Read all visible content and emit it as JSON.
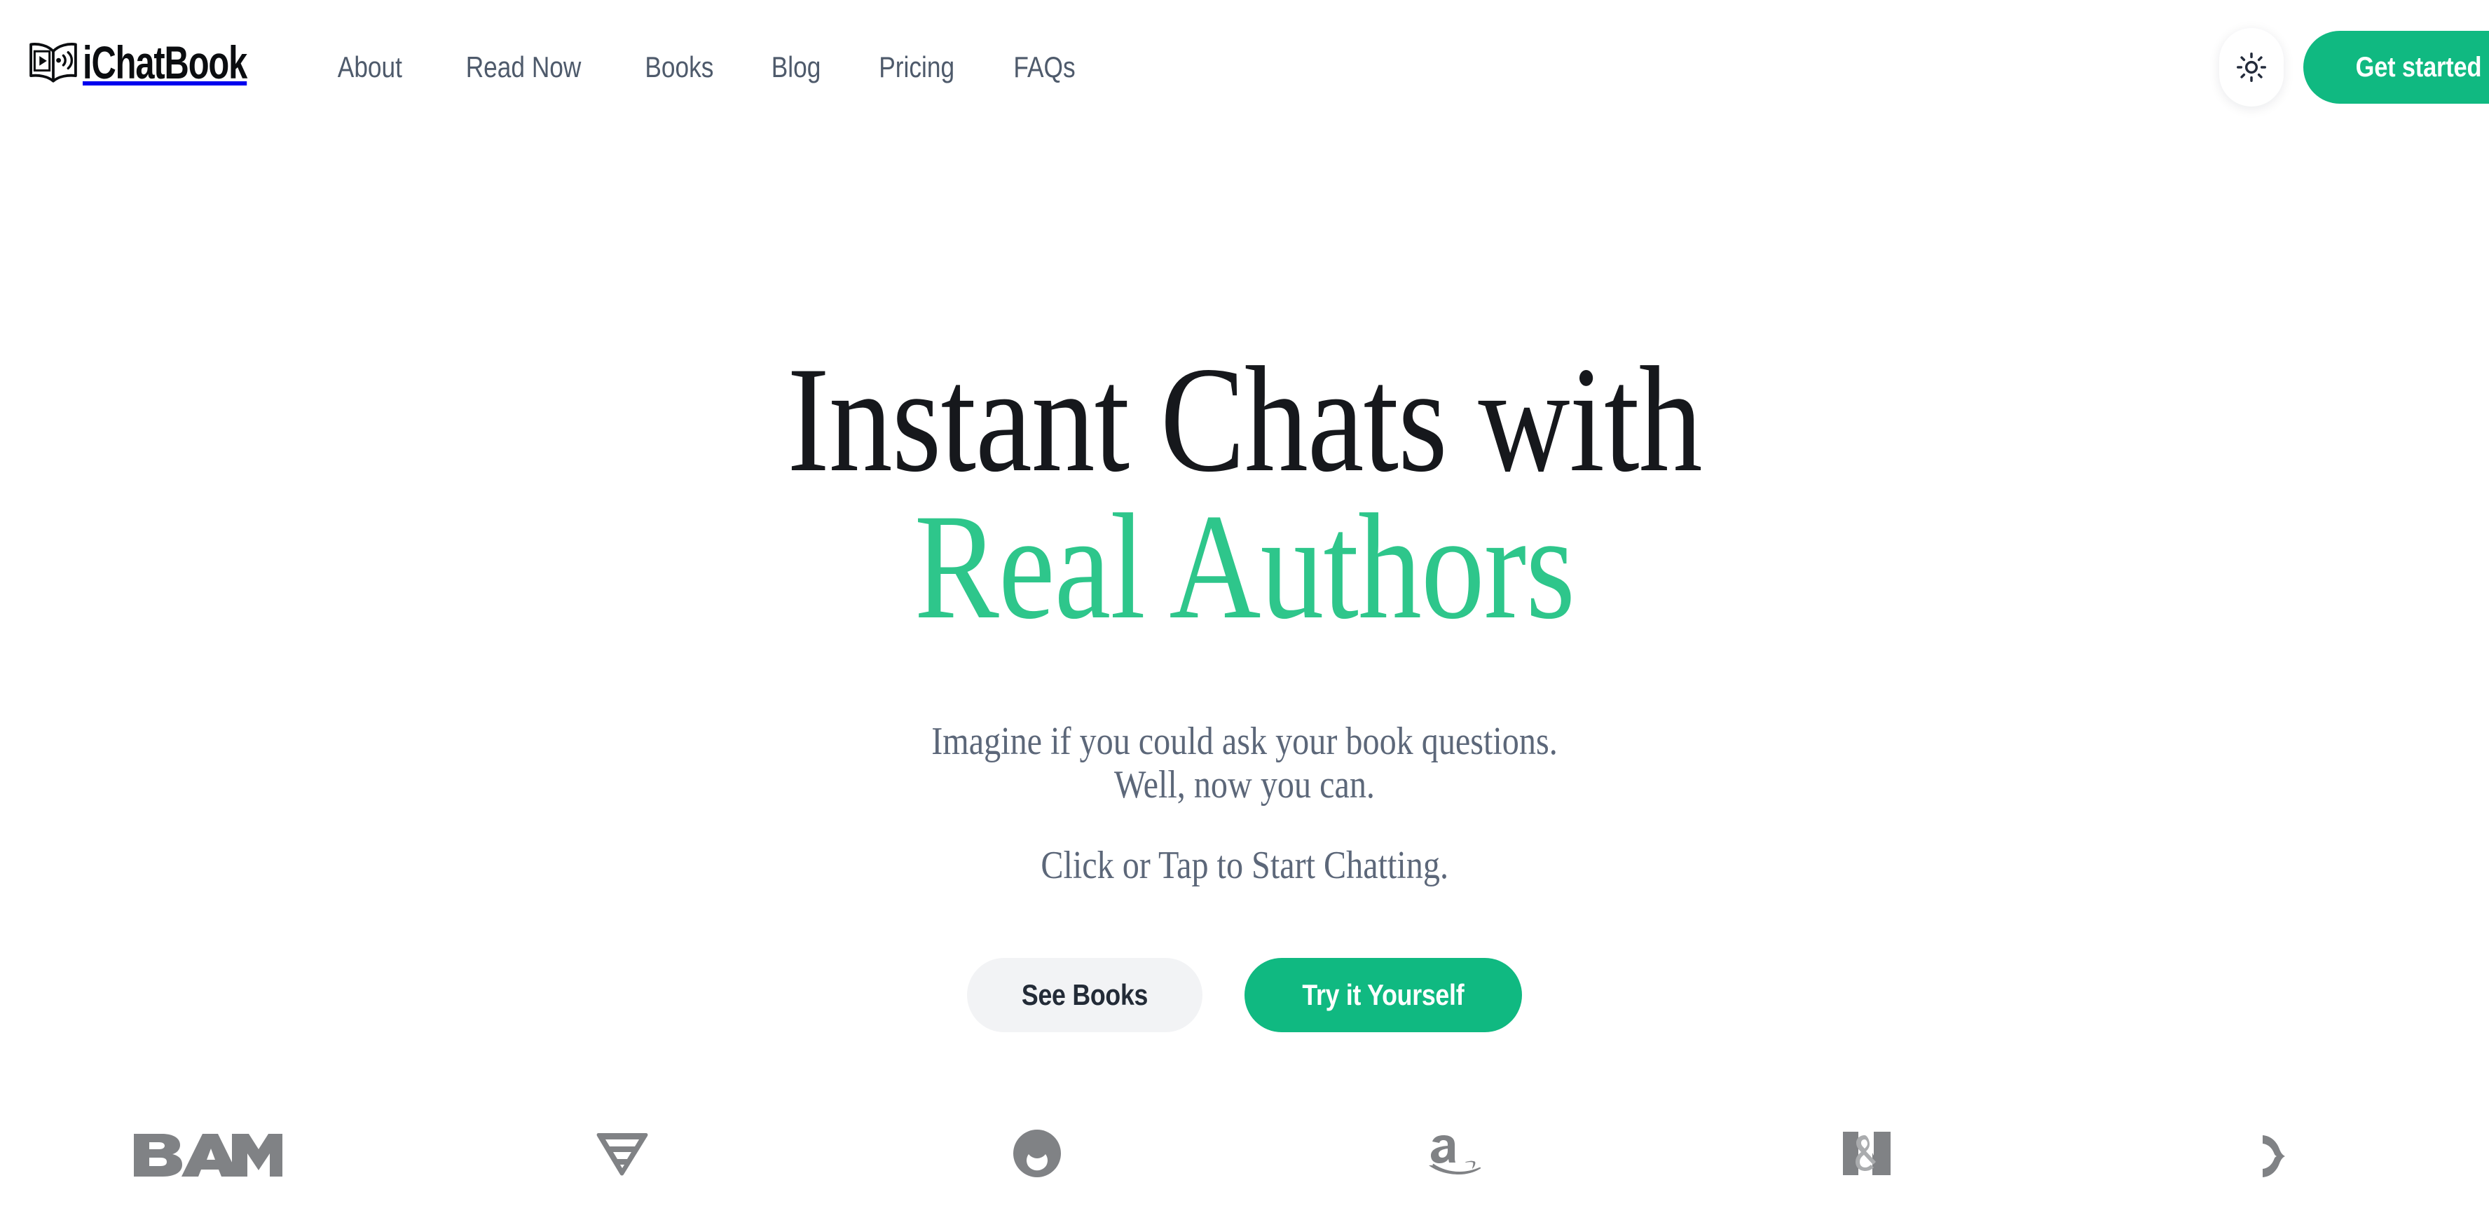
{
  "brand": {
    "name": "iChatBook",
    "logo_icon": "open-book-with-play-and-soundwaves-icon"
  },
  "header": {
    "nav": [
      {
        "label": "About"
      },
      {
        "label": "Read Now"
      },
      {
        "label": "Books"
      },
      {
        "label": "Blog"
      },
      {
        "label": "Pricing"
      },
      {
        "label": "FAQs"
      }
    ],
    "theme_toggle_icon": "sun-icon",
    "get_started_label": "Get started"
  },
  "hero": {
    "title_line1": "Instant Chats with",
    "title_line2": "Real Authors",
    "subtitle_line1": "Imagine if you could ask your book questions.",
    "subtitle_line2": "Well, now you can.",
    "cta_prompt": "Click or Tap to Start Chatting.",
    "secondary_button": "See Books",
    "primary_button": "Try it Yourself"
  },
  "logo_strip": {
    "logos": [
      {
        "name": "BAM!",
        "icon": "books-a-million-logo"
      },
      {
        "name": "Vellum",
        "icon": "inverted-triangle-logo"
      },
      {
        "name": "Kobo",
        "icon": "kobo-logo"
      },
      {
        "name": "Amazon",
        "icon": "amazon-logo"
      },
      {
        "name": "B&N",
        "icon": "barnes-and-noble-logo"
      },
      {
        "name": "Bookshop",
        "icon": "wing-logo"
      }
    ]
  },
  "colors": {
    "accent_green": "#10b981",
    "heading_green": "#2ec68b",
    "nav_text": "#4e5a6b",
    "body_text": "#5c6779",
    "heading_dark": "#16181c",
    "secondary_button_bg": "#f2f3f5",
    "logo_gray": "#808285",
    "page_background": "#ffffff"
  }
}
